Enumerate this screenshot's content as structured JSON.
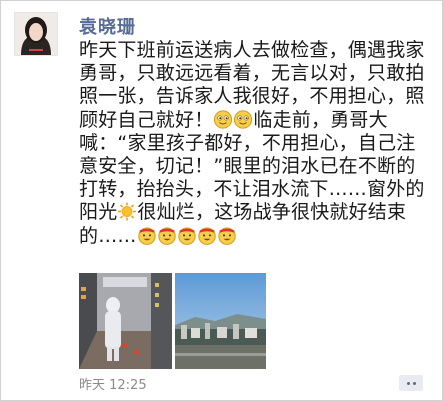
{
  "post": {
    "author": "袁晓珊",
    "segments": [
      {
        "type": "text",
        "value": "昨天下班前运送病人去做检查，偶遇我家勇哥，只敢远远看着，无言以对，只敢拍照一张，告诉家人我很好，不用担心，照顾好自己就好！"
      },
      {
        "type": "emoji",
        "icon": "smile-emoji-icon"
      },
      {
        "type": "emoji",
        "icon": "smile-emoji-icon"
      },
      {
        "type": "text",
        "value": "临走前，勇哥大喊：“家里孩子都好，不用担心，自己注意安全，切记！”眼里的泪水已在不断的打转，抬抬头，不让泪水流下……窗外的阳光"
      },
      {
        "type": "emoji",
        "icon": "sun-emoji-icon"
      },
      {
        "type": "text",
        "value": "很灿烂，这场战争很快就好结束的……"
      },
      {
        "type": "emoji",
        "icon": "cheer-emoji-icon"
      },
      {
        "type": "emoji",
        "icon": "cheer-emoji-icon"
      },
      {
        "type": "emoji",
        "icon": "cheer-emoji-icon"
      },
      {
        "type": "emoji",
        "icon": "cheer-emoji-icon"
      },
      {
        "type": "emoji",
        "icon": "cheer-emoji-icon"
      }
    ],
    "photos": [
      {
        "name": "hospital-corridor-photo"
      },
      {
        "name": "city-view-photo"
      }
    ],
    "timestamp": "昨天 12:25",
    "colors": {
      "author": "#576b95",
      "text": "#1a1a1a",
      "timestamp": "#8a8a8a"
    }
  }
}
